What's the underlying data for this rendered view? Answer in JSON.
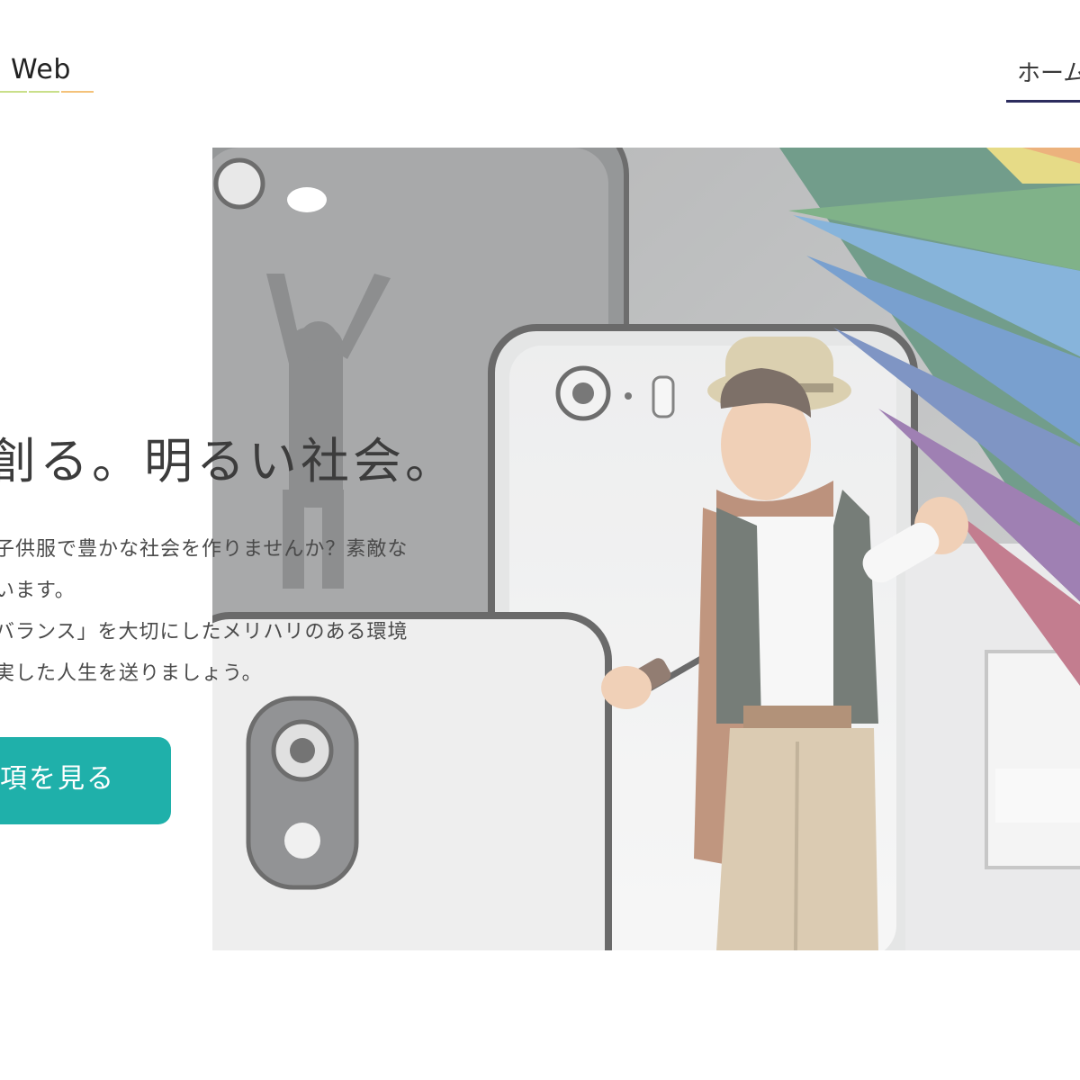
{
  "header": {
    "logo_text": "Web",
    "logo_underline_colors": [
      "#c9df8a",
      "#c9df8a",
      "#f4c27a"
    ],
    "nav": {
      "home_label": "ホーム",
      "active_underline_color": "#2c2c5e"
    }
  },
  "hero": {
    "headline": "創る。明るい社会。",
    "body_lines": [
      "子供服で豊かな社会を作りませんか？素敵な",
      "います。",
      "バランス」を大切にしたメリハリのある環境",
      "実した人生を送りましょう。"
    ],
    "cta_label": "項を見る",
    "cta_color": "#1fb0aa",
    "image": {
      "subject": "boy-with-rainbow-umbrella",
      "icon_name": "hero-photo"
    }
  }
}
